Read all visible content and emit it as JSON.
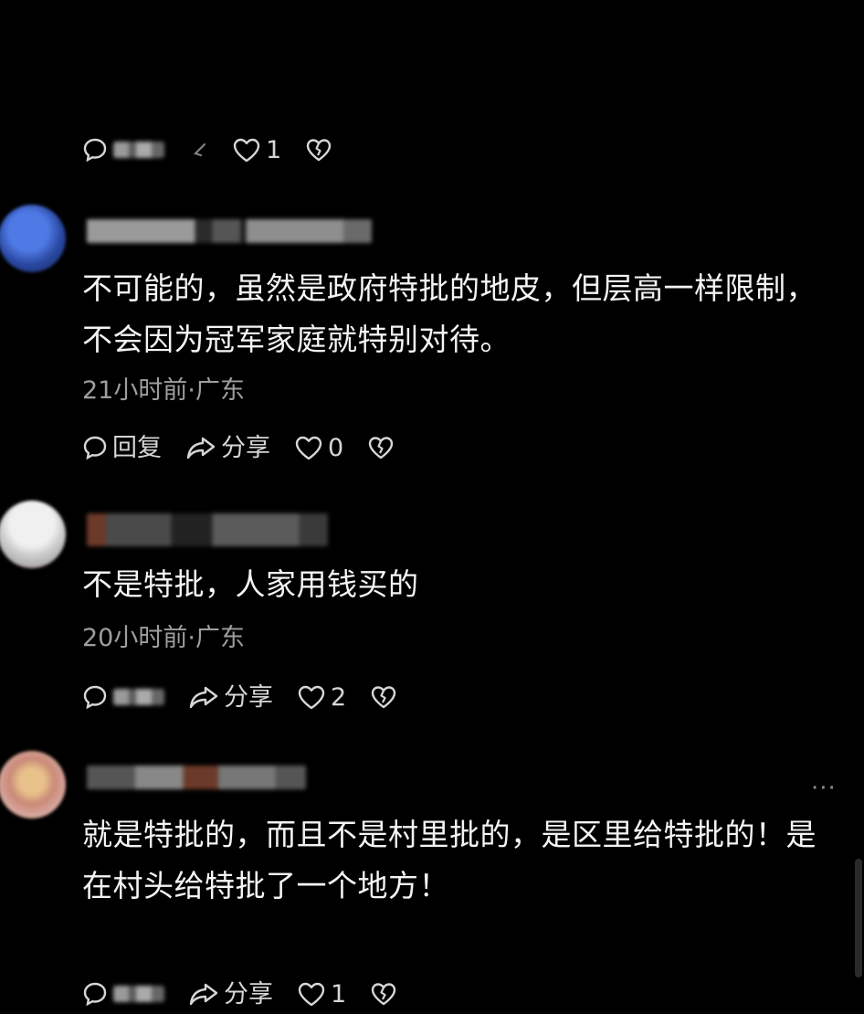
{
  "top_actions": {
    "like_count": "1"
  },
  "comments": [
    {
      "text_line1": "不可能的，虽然是政府特批的地皮，但层高一样限制，",
      "text_line2": "不会因为冠军家庭就特别对待。",
      "meta": "21小时前·广东",
      "reply_label": "回复",
      "share_label": "分享",
      "like_count": "0"
    },
    {
      "text_line1": "不是特批，人家用钱买的",
      "meta": "20小时前·广东",
      "share_label": "分享",
      "like_count": "2"
    },
    {
      "text_line1": "就是特批的，而且不是村里批的，是区里给特批的！是",
      "text_line2": "在村头给特批了一个地方！",
      "share_label": "分享",
      "like_count": "1"
    }
  ],
  "more_label": "···",
  "icons": {
    "comment": "comment-bubble-icon",
    "share": "share-arrow-icon",
    "like": "heart-icon",
    "dislike": "broken-heart-icon"
  },
  "colors": {
    "background": "#000000",
    "text": "#f4f4f4",
    "meta": "#9e9e9e"
  }
}
